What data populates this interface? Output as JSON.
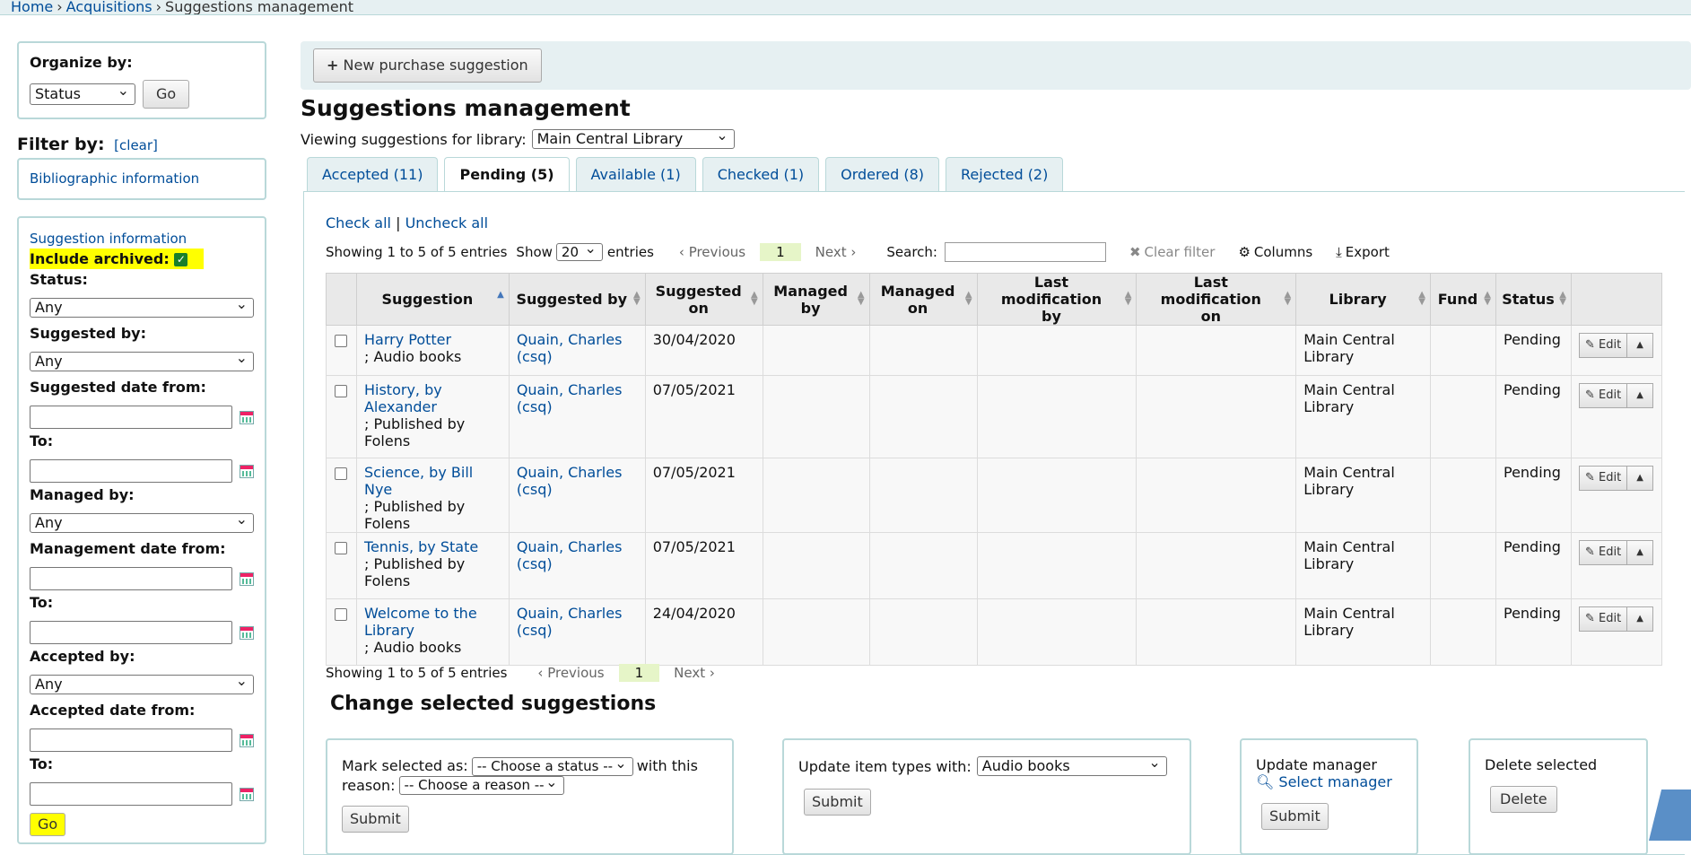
{
  "breadcrumb": {
    "home": "Home",
    "acquisitions": "Acquisitions",
    "current": "Suggestions management",
    "sep": "›"
  },
  "sidebar": {
    "organize_label": "Organize by:",
    "organize_value": "Status",
    "go": "Go",
    "filter_heading": "Filter by:",
    "clear": "[clear]",
    "biblio": "Bibliographic information",
    "sug_info": "Suggestion information",
    "include_archived": "Include archived:",
    "status_label": "Status:",
    "suggested_by_label": "Suggested by:",
    "suggested_from_label": "Suggested date from:",
    "to_label": "To:",
    "managed_by_label": "Managed by:",
    "management_from_label": "Management date from:",
    "accepted_by_label": "Accepted by:",
    "accepted_from_label": "Accepted date from:",
    "any": "Any",
    "go2": "Go"
  },
  "toolbar": {
    "new_suggestion": "New purchase suggestion"
  },
  "page_title": "Suggestions management",
  "viewing": {
    "label": "Viewing suggestions for library:",
    "library": "Main Central Library"
  },
  "tabs": [
    {
      "label": "Accepted (11)"
    },
    {
      "label": "Pending (5)"
    },
    {
      "label": "Available (1)"
    },
    {
      "label": "Checked (1)"
    },
    {
      "label": "Ordered (8)"
    },
    {
      "label": "Rejected (2)"
    }
  ],
  "table_controls": {
    "check_all": "Check all",
    "pipe": "|",
    "uncheck_all": "Uncheck all",
    "showing": "Showing 1 to 5 of 5 entries",
    "show": "Show",
    "entries_count": "20",
    "entries": "entries",
    "previous": "Previous",
    "page": "1",
    "next": "Next",
    "search": "Search:",
    "clear_filter": "Clear filter",
    "columns": "Columns",
    "export": "Export"
  },
  "columns": {
    "suggestion": "Suggestion",
    "suggested_by": "Suggested by",
    "suggested_on_1": "Suggested",
    "suggested_on_2": "on",
    "managed_by_1": "Managed",
    "managed_by_2": "by",
    "managed_on_1": "Managed",
    "managed_on_2": "on",
    "last_mod_by_1": "Last modification",
    "last_mod_by_2": "by",
    "last_mod_on_1": "Last modification",
    "last_mod_on_2": "on",
    "library": "Library",
    "fund": "Fund",
    "status": "Status"
  },
  "rows": [
    {
      "title": "Harry Potter",
      "detail": "; Audio books",
      "by1": "Quain, Charles",
      "by2": "(csq)",
      "on": "30/04/2020",
      "lib1": "Main Central",
      "lib2": "Library",
      "status": "Pending",
      "edit": "Edit"
    },
    {
      "title": "History, by Alexander",
      "detail": "; Published by Folens",
      "by1": "Quain, Charles",
      "by2": "(csq)",
      "on": "07/05/2021",
      "lib1": "Main Central",
      "lib2": "Library",
      "status": "Pending",
      "edit": "Edit"
    },
    {
      "title": "Science, by Bill Nye",
      "detail": "; Published by Folens",
      "by1": "Quain, Charles",
      "by2": "(csq)",
      "on": "07/05/2021",
      "lib1": "Main Central",
      "lib2": "Library",
      "status": "Pending",
      "edit": "Edit"
    },
    {
      "title": "Tennis, by State",
      "detail": "; Published by Folens",
      "by1": "Quain, Charles",
      "by2": "(csq)",
      "on": "07/05/2021",
      "lib1": "Main Central",
      "lib2": "Library",
      "status": "Pending",
      "edit": "Edit"
    },
    {
      "title": "Welcome to the Library",
      "detail": "; Audio books",
      "by1": "Quain, Charles",
      "by2": "(csq)",
      "on": "24/04/2020",
      "lib1": "Main Central",
      "lib2": "Library",
      "status": "Pending",
      "edit": "Edit"
    }
  ],
  "change": {
    "title": "Change selected suggestions",
    "mark_label": "Mark selected as:",
    "choose_status": "-- Choose a status --",
    "with_reason": "with this",
    "reason_label": "reason:",
    "choose_reason": "-- Choose a reason --",
    "submit": "Submit",
    "update_types": "Update item types with:",
    "item_type": "Audio books",
    "update_manager": "Update manager",
    "select_manager": "Select manager",
    "delete_selected": "Delete selected",
    "delete": "Delete"
  }
}
